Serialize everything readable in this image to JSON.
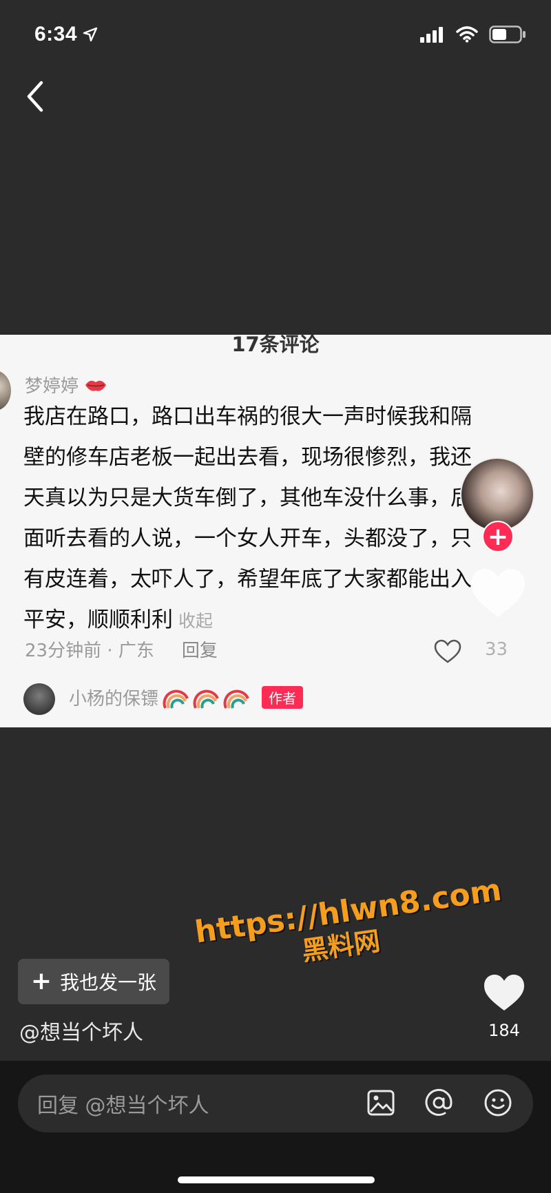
{
  "status_bar": {
    "time": "6:34"
  },
  "screenshot": {
    "header": "17条评论",
    "comment": {
      "username": "梦婷婷",
      "lines": [
        "我店在路口，路口出车祸的很大一声时候我和隔",
        "壁的修车店老板一起出去看，现场很惨烈，我还",
        "天真以为只是大货车倒了，其他车没什么事，后",
        "面听去看的人说，一个女人开车，头都没了，只",
        "有皮连着，太吓人了，希望年底了大家都能出入",
        "平安，顺顺利利"
      ],
      "collapse": "收起",
      "time_location": "23分钟前 · 广东",
      "reply": "回复",
      "like_count": "33"
    },
    "sub_comment": {
      "username": "小杨的保镖",
      "author_tag": "作者"
    }
  },
  "post_button": {
    "label": "我也发一张"
  },
  "author_handle": "@想当个坏人",
  "watermark": {
    "url": "https://hlwn8.com",
    "cn": "黑料网"
  },
  "like": {
    "count": "184"
  },
  "reply_bar": {
    "placeholder": "回复 @想当个坏人"
  },
  "colors": {
    "accent": "#fe2c55",
    "watermark": "#f59d1c",
    "background": "#2b2b2b"
  }
}
